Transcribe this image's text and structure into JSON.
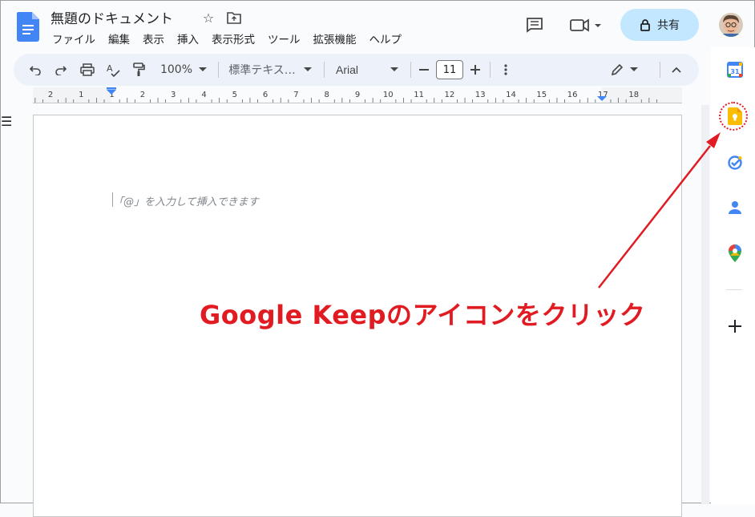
{
  "header": {
    "title": "無題のドキュメント",
    "share_label": "共有",
    "icons": [
      "docs-logo-icon",
      "star-icon",
      "move-to-folder-icon",
      "comments-icon",
      "meet-icon",
      "lock-icon",
      "avatar"
    ]
  },
  "menu": [
    "ファイル",
    "編集",
    "表示",
    "挿入",
    "表示形式",
    "ツール",
    "拡張機能",
    "ヘルプ"
  ],
  "toolbar": {
    "zoom": "100%",
    "style": "標準テキス…",
    "font": "Arial",
    "font_size": "11"
  },
  "ruler": {
    "labels": [
      "2",
      "1",
      "1",
      "2",
      "3",
      "4",
      "5",
      "6",
      "7",
      "8",
      "9",
      "10",
      "11",
      "12",
      "13",
      "14",
      "15",
      "16",
      "17",
      "18"
    ]
  },
  "document": {
    "placeholder": "「@」を入力して挿入できます"
  },
  "side_panel": {
    "calendar_day": "31",
    "items": [
      "calendar-icon",
      "keep-icon",
      "tasks-icon",
      "contacts-icon",
      "maps-icon",
      "add-icon"
    ]
  },
  "annotation": {
    "text": "Google Keepのアイコンをクリック",
    "color": "#e11b22"
  },
  "colors": {
    "accent": "#c2e7ff",
    "toolbar_bg": "#edf2fa",
    "docs_blue": "#4285f4",
    "keep_yellow": "#fbbc04"
  }
}
